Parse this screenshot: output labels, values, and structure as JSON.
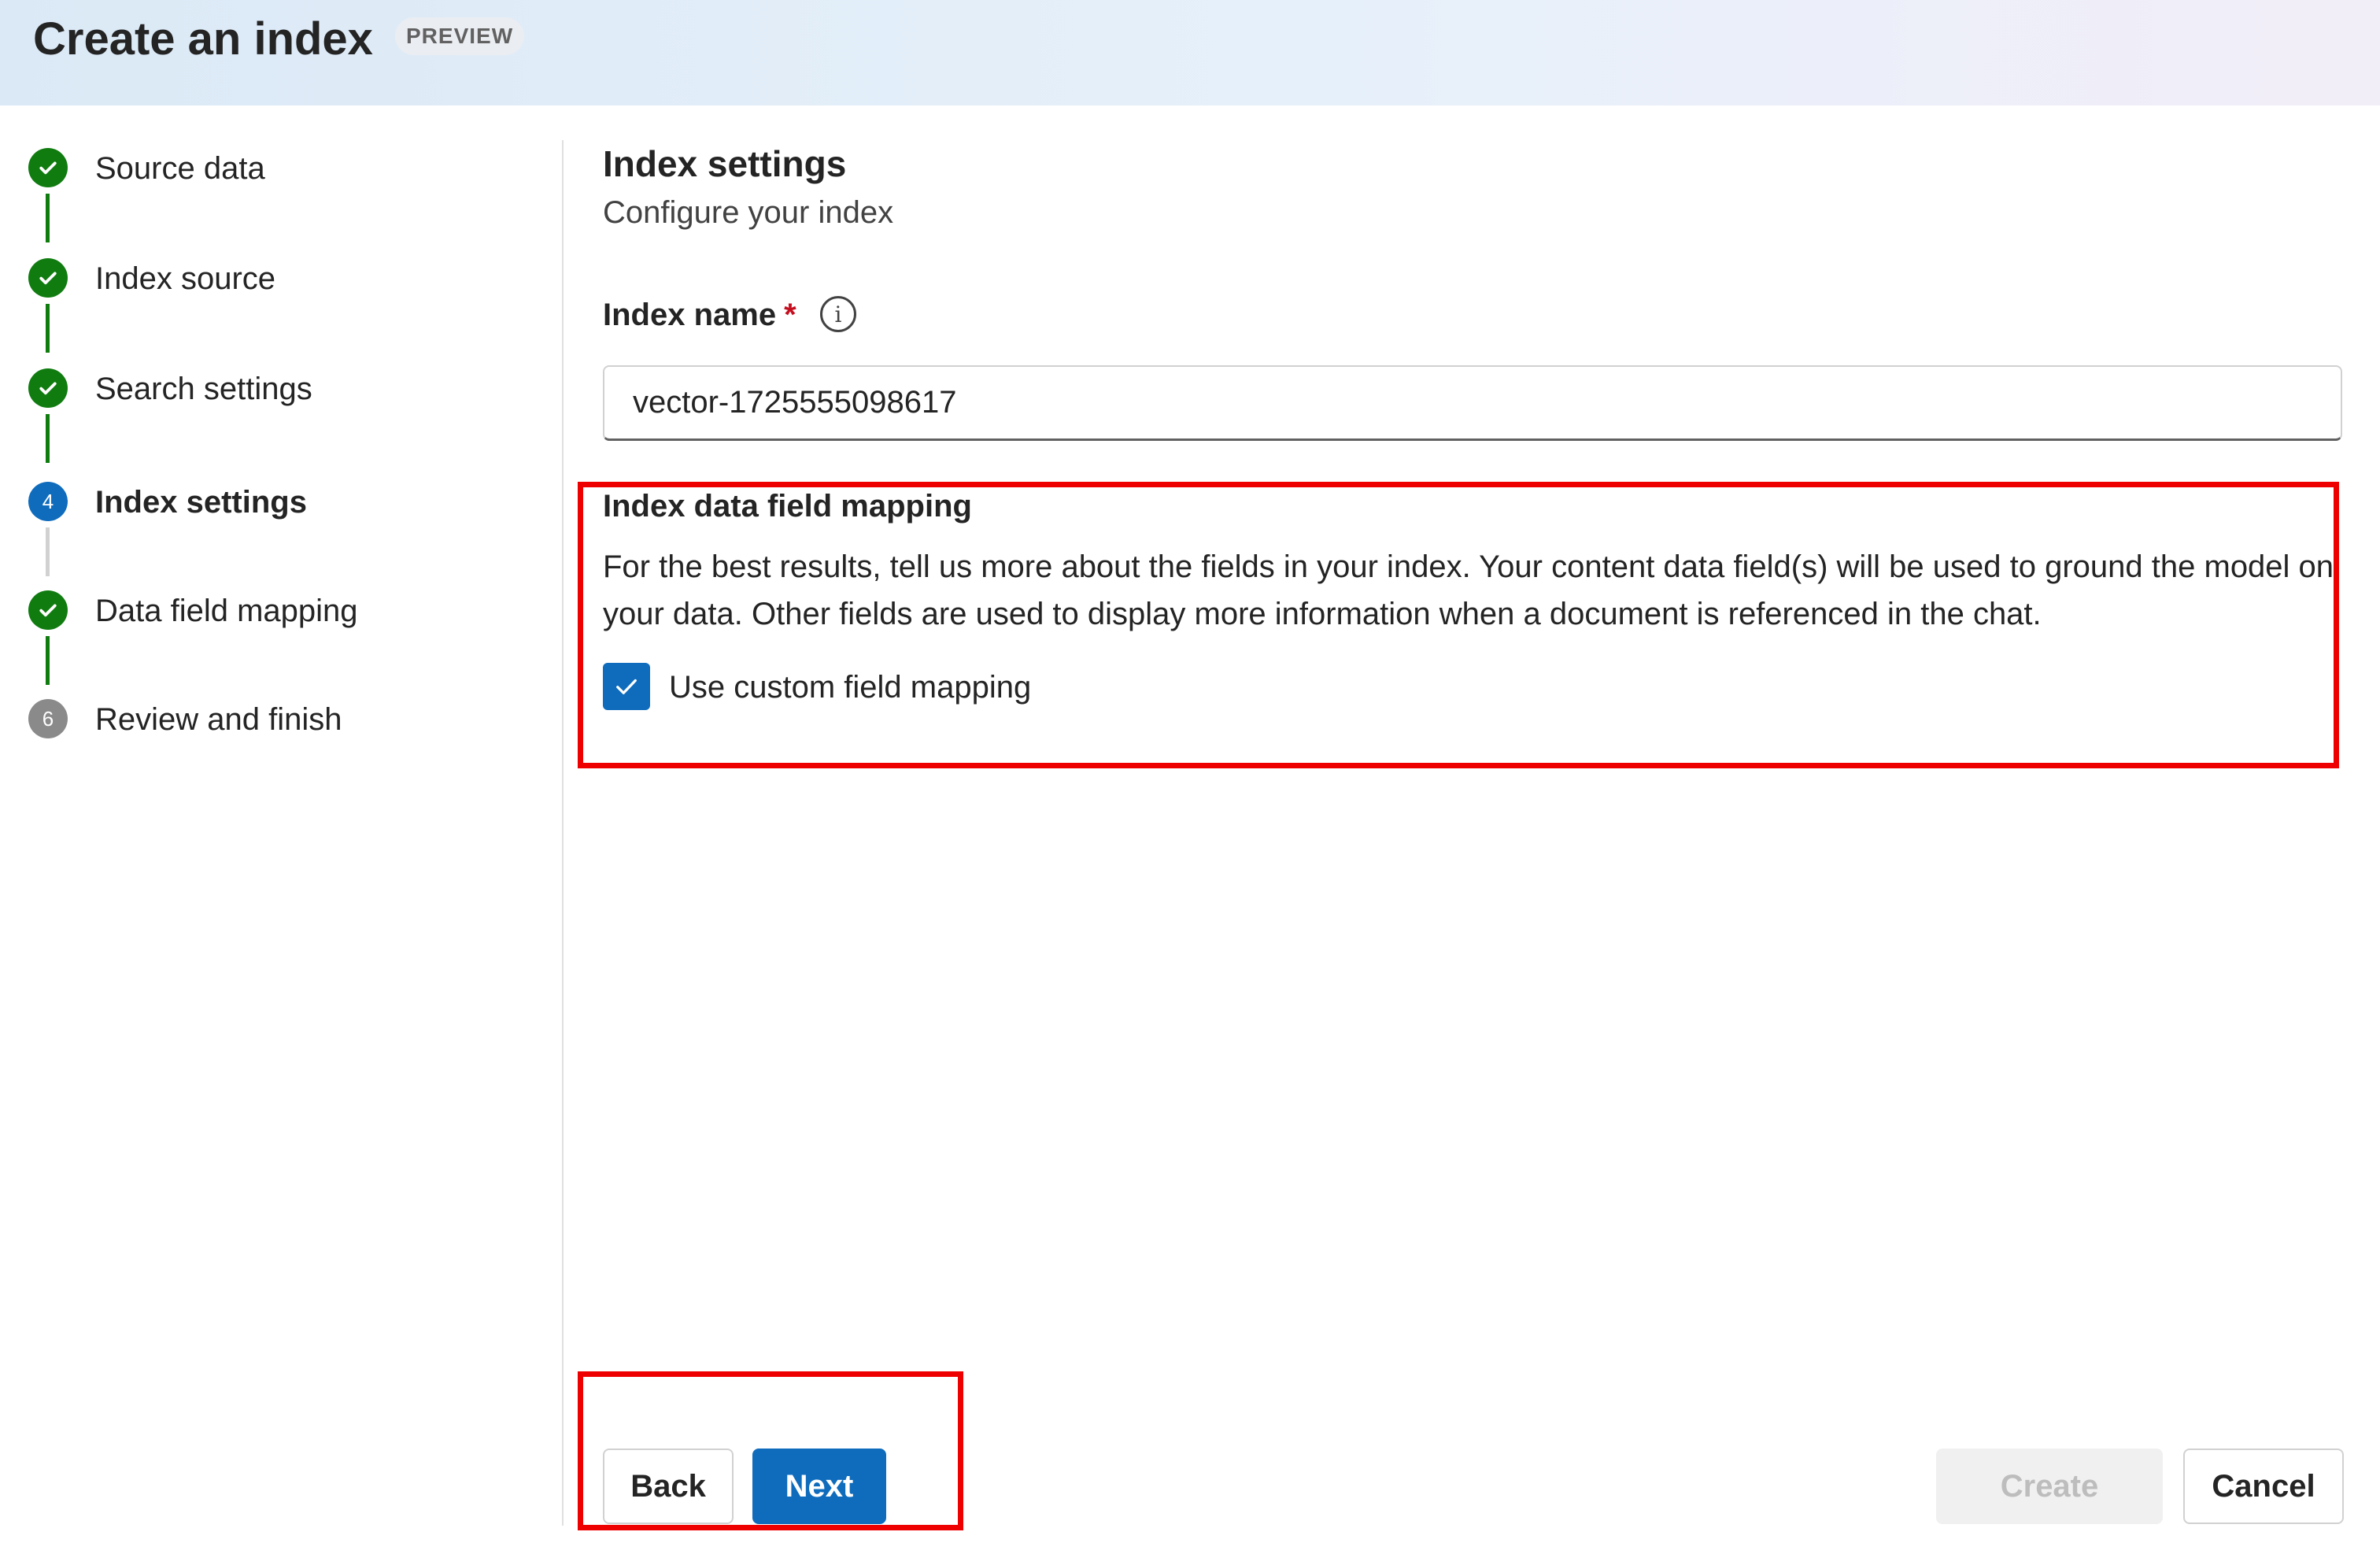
{
  "header": {
    "title": "Create an index",
    "badge": "PREVIEW"
  },
  "stepper": {
    "steps": [
      {
        "label": "Source data",
        "status": "done",
        "number": "1"
      },
      {
        "label": "Index source",
        "status": "done",
        "number": "2"
      },
      {
        "label": "Search settings",
        "status": "done",
        "number": "3"
      },
      {
        "label": "Index settings",
        "status": "current",
        "number": "4"
      },
      {
        "label": "Data field mapping",
        "status": "done",
        "number": "5"
      },
      {
        "label": "Review and finish",
        "status": "pending",
        "number": "6"
      }
    ]
  },
  "main": {
    "title": "Index settings",
    "subtitle": "Configure your index",
    "index_name": {
      "label": "Index name",
      "required_mark": "*",
      "info_icon": "info-icon",
      "value": "vector-1725555098617"
    },
    "mapping": {
      "title": "Index data field mapping",
      "description": "For the best results, tell us more about the fields in your index. Your content data field(s) will be used to ground the model on your data. Other fields are used to display more information when a document is referenced in the chat.",
      "checkbox_label": "Use custom field mapping",
      "checkbox_checked": true
    }
  },
  "footer": {
    "back_label": "Back",
    "next_label": "Next",
    "create_label": "Create",
    "cancel_label": "Cancel"
  },
  "colors": {
    "accent": "#0f6cbd",
    "success": "#107c10",
    "highlight": "#ee0000",
    "required": "#c50f1f"
  }
}
